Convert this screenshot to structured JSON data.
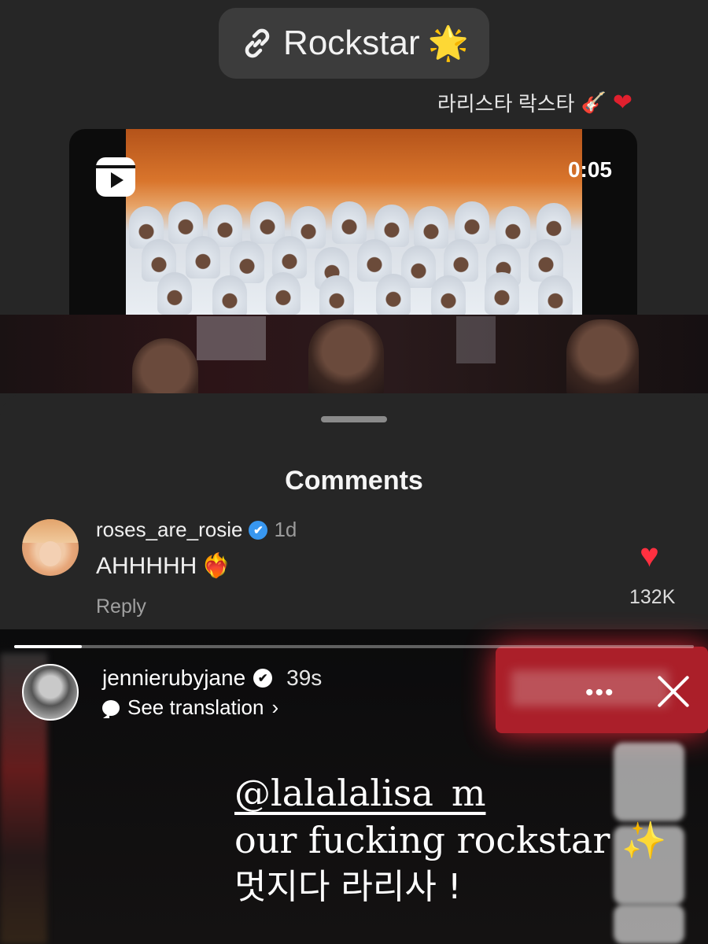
{
  "link_pill": {
    "label": "Rockstar",
    "star": "🌟"
  },
  "message_caption": {
    "text": "라리스타 락스타",
    "guitar_emoji": "🎸",
    "heart_emoji": "❤"
  },
  "reel": {
    "duration": "0:05"
  },
  "comments_sheet": {
    "title": "Comments",
    "comment": {
      "username": "roses_are_rosie",
      "verified": "✔",
      "time": "1d",
      "text": "AHHHHH",
      "emoji": "❤‍🔥",
      "reply_label": "Reply",
      "like_icon": "♥",
      "like_count": "132K"
    }
  },
  "story": {
    "progress": 0.1,
    "username": "jennierubyjane",
    "verified": "✔",
    "time": "39s",
    "see_translation": "See translation",
    "chevron": "›",
    "more": "•••",
    "mention": "@lalalalisa_m",
    "line2": "our fucking rockstar",
    "line2_emoji": "✨",
    "line3": "멋지다 라리사 !"
  },
  "colors": {
    "like_red": "#ff3040",
    "verified_blue": "#3897f0",
    "neon_red": "#c7232f"
  }
}
